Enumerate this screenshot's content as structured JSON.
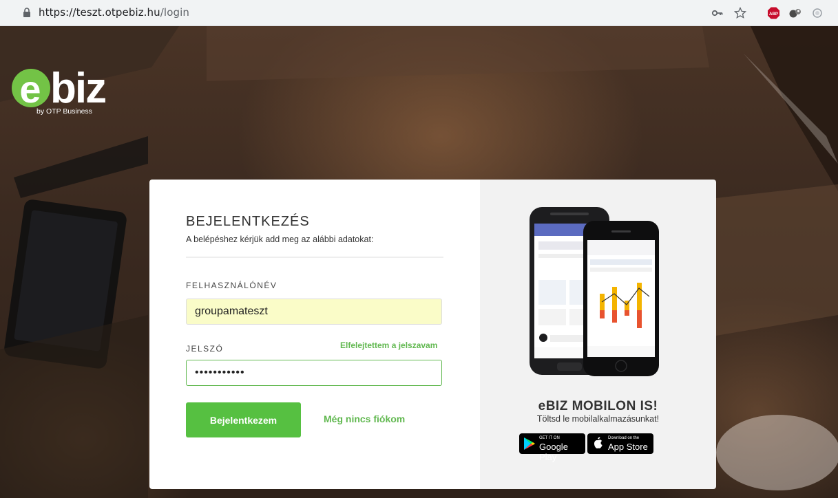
{
  "browser": {
    "url_host": "https://teszt.otpebiz.hu",
    "url_path": "/login",
    "toolbar_icons": [
      "key-icon",
      "star-icon",
      "adblock-icon",
      "extension-icon",
      "circle-icon"
    ],
    "adblock_label": "ABP"
  },
  "logo": {
    "text": "ebiz",
    "tagline": "by OTP Business"
  },
  "login": {
    "title": "BEJELENTKEZÉS",
    "subtitle": "A belépéshez kérjük add meg az alábbi adatokat:",
    "username_label": "FELHASZNÁLÓNÉV",
    "username_value": "groupamateszt",
    "password_label": "JELSZÓ",
    "password_value": "•••••••••••",
    "forgot_link": "Elfelejtettem a jelszavam",
    "login_button": "Bejelentkezem",
    "no_account_link": "Még nincs fiókom"
  },
  "mobile": {
    "title": "eBIZ MOBILON IS!",
    "subtitle": "Töltsd le mobilalkalmazásunkat!",
    "google_play_small": "GET IT ON",
    "google_play_big": "Google Play",
    "app_store_small": "Download on the",
    "app_store_big": "App Store"
  },
  "colors": {
    "brand_green": "#61b850",
    "button_green": "#56c041",
    "autofill_yellow": "#fafcc8"
  }
}
